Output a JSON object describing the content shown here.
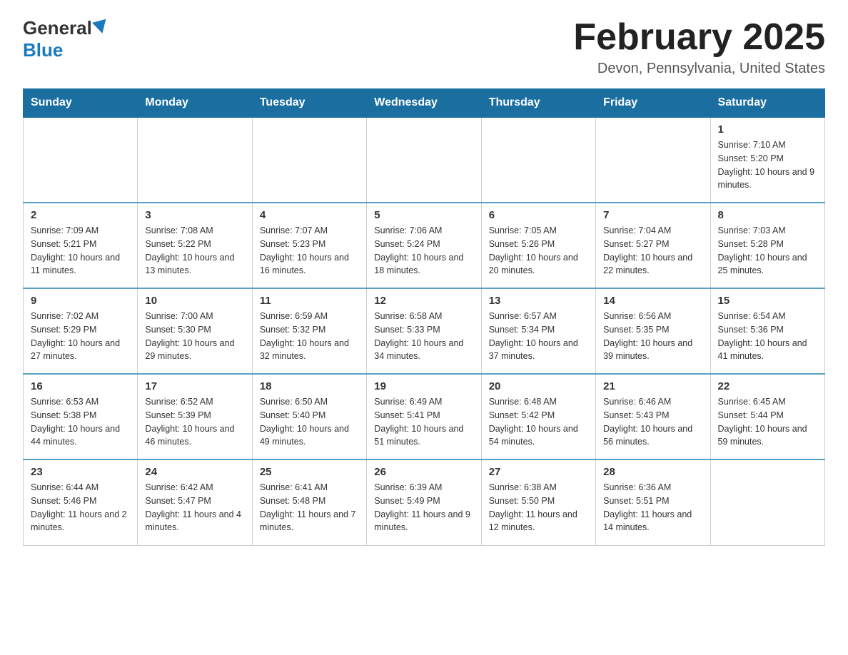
{
  "logo": {
    "general": "General",
    "blue": "Blue"
  },
  "header": {
    "month_title": "February 2025",
    "location": "Devon, Pennsylvania, United States"
  },
  "weekdays": [
    "Sunday",
    "Monday",
    "Tuesday",
    "Wednesday",
    "Thursday",
    "Friday",
    "Saturday"
  ],
  "weeks": [
    [
      {
        "day": null
      },
      {
        "day": null
      },
      {
        "day": null
      },
      {
        "day": null
      },
      {
        "day": null
      },
      {
        "day": null
      },
      {
        "day": 1,
        "sunrise": "Sunrise: 7:10 AM",
        "sunset": "Sunset: 5:20 PM",
        "daylight": "Daylight: 10 hours and 9 minutes."
      }
    ],
    [
      {
        "day": 2,
        "sunrise": "Sunrise: 7:09 AM",
        "sunset": "Sunset: 5:21 PM",
        "daylight": "Daylight: 10 hours and 11 minutes."
      },
      {
        "day": 3,
        "sunrise": "Sunrise: 7:08 AM",
        "sunset": "Sunset: 5:22 PM",
        "daylight": "Daylight: 10 hours and 13 minutes."
      },
      {
        "day": 4,
        "sunrise": "Sunrise: 7:07 AM",
        "sunset": "Sunset: 5:23 PM",
        "daylight": "Daylight: 10 hours and 16 minutes."
      },
      {
        "day": 5,
        "sunrise": "Sunrise: 7:06 AM",
        "sunset": "Sunset: 5:24 PM",
        "daylight": "Daylight: 10 hours and 18 minutes."
      },
      {
        "day": 6,
        "sunrise": "Sunrise: 7:05 AM",
        "sunset": "Sunset: 5:26 PM",
        "daylight": "Daylight: 10 hours and 20 minutes."
      },
      {
        "day": 7,
        "sunrise": "Sunrise: 7:04 AM",
        "sunset": "Sunset: 5:27 PM",
        "daylight": "Daylight: 10 hours and 22 minutes."
      },
      {
        "day": 8,
        "sunrise": "Sunrise: 7:03 AM",
        "sunset": "Sunset: 5:28 PM",
        "daylight": "Daylight: 10 hours and 25 minutes."
      }
    ],
    [
      {
        "day": 9,
        "sunrise": "Sunrise: 7:02 AM",
        "sunset": "Sunset: 5:29 PM",
        "daylight": "Daylight: 10 hours and 27 minutes."
      },
      {
        "day": 10,
        "sunrise": "Sunrise: 7:00 AM",
        "sunset": "Sunset: 5:30 PM",
        "daylight": "Daylight: 10 hours and 29 minutes."
      },
      {
        "day": 11,
        "sunrise": "Sunrise: 6:59 AM",
        "sunset": "Sunset: 5:32 PM",
        "daylight": "Daylight: 10 hours and 32 minutes."
      },
      {
        "day": 12,
        "sunrise": "Sunrise: 6:58 AM",
        "sunset": "Sunset: 5:33 PM",
        "daylight": "Daylight: 10 hours and 34 minutes."
      },
      {
        "day": 13,
        "sunrise": "Sunrise: 6:57 AM",
        "sunset": "Sunset: 5:34 PM",
        "daylight": "Daylight: 10 hours and 37 minutes."
      },
      {
        "day": 14,
        "sunrise": "Sunrise: 6:56 AM",
        "sunset": "Sunset: 5:35 PM",
        "daylight": "Daylight: 10 hours and 39 minutes."
      },
      {
        "day": 15,
        "sunrise": "Sunrise: 6:54 AM",
        "sunset": "Sunset: 5:36 PM",
        "daylight": "Daylight: 10 hours and 41 minutes."
      }
    ],
    [
      {
        "day": 16,
        "sunrise": "Sunrise: 6:53 AM",
        "sunset": "Sunset: 5:38 PM",
        "daylight": "Daylight: 10 hours and 44 minutes."
      },
      {
        "day": 17,
        "sunrise": "Sunrise: 6:52 AM",
        "sunset": "Sunset: 5:39 PM",
        "daylight": "Daylight: 10 hours and 46 minutes."
      },
      {
        "day": 18,
        "sunrise": "Sunrise: 6:50 AM",
        "sunset": "Sunset: 5:40 PM",
        "daylight": "Daylight: 10 hours and 49 minutes."
      },
      {
        "day": 19,
        "sunrise": "Sunrise: 6:49 AM",
        "sunset": "Sunset: 5:41 PM",
        "daylight": "Daylight: 10 hours and 51 minutes."
      },
      {
        "day": 20,
        "sunrise": "Sunrise: 6:48 AM",
        "sunset": "Sunset: 5:42 PM",
        "daylight": "Daylight: 10 hours and 54 minutes."
      },
      {
        "day": 21,
        "sunrise": "Sunrise: 6:46 AM",
        "sunset": "Sunset: 5:43 PM",
        "daylight": "Daylight: 10 hours and 56 minutes."
      },
      {
        "day": 22,
        "sunrise": "Sunrise: 6:45 AM",
        "sunset": "Sunset: 5:44 PM",
        "daylight": "Daylight: 10 hours and 59 minutes."
      }
    ],
    [
      {
        "day": 23,
        "sunrise": "Sunrise: 6:44 AM",
        "sunset": "Sunset: 5:46 PM",
        "daylight": "Daylight: 11 hours and 2 minutes."
      },
      {
        "day": 24,
        "sunrise": "Sunrise: 6:42 AM",
        "sunset": "Sunset: 5:47 PM",
        "daylight": "Daylight: 11 hours and 4 minutes."
      },
      {
        "day": 25,
        "sunrise": "Sunrise: 6:41 AM",
        "sunset": "Sunset: 5:48 PM",
        "daylight": "Daylight: 11 hours and 7 minutes."
      },
      {
        "day": 26,
        "sunrise": "Sunrise: 6:39 AM",
        "sunset": "Sunset: 5:49 PM",
        "daylight": "Daylight: 11 hours and 9 minutes."
      },
      {
        "day": 27,
        "sunrise": "Sunrise: 6:38 AM",
        "sunset": "Sunset: 5:50 PM",
        "daylight": "Daylight: 11 hours and 12 minutes."
      },
      {
        "day": 28,
        "sunrise": "Sunrise: 6:36 AM",
        "sunset": "Sunset: 5:51 PM",
        "daylight": "Daylight: 11 hours and 14 minutes."
      },
      {
        "day": null
      }
    ]
  ]
}
